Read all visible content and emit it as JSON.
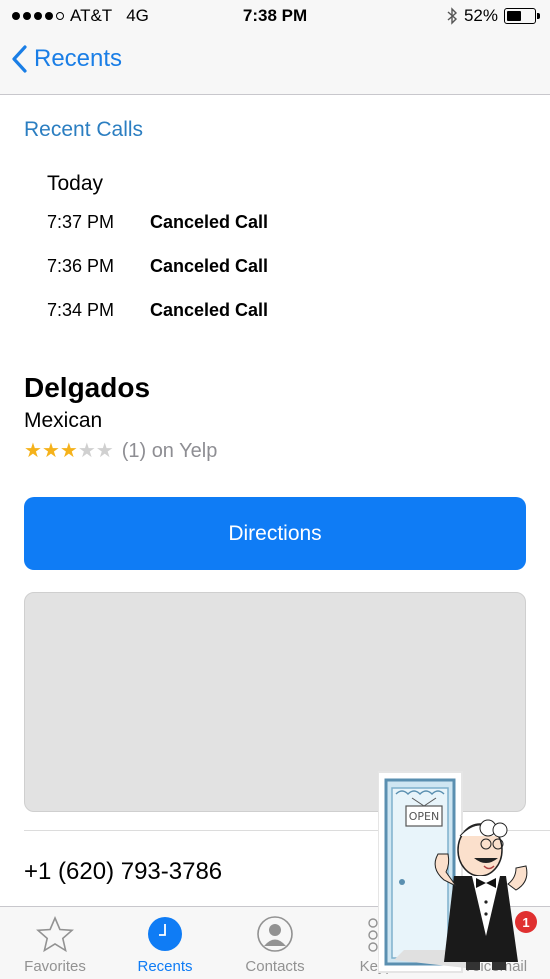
{
  "status_bar": {
    "carrier": "AT&T",
    "network": "4G",
    "time": "7:38 PM",
    "battery_percent": "52%",
    "battery_level": 0.52,
    "signal_bars": 4
  },
  "nav": {
    "back_label": "Recents"
  },
  "recent_calls": {
    "title": "Recent Calls",
    "day": "Today",
    "calls": [
      {
        "time": "7:37 PM",
        "status": "Canceled Call"
      },
      {
        "time": "7:36 PM",
        "status": "Canceled Call"
      },
      {
        "time": "7:34 PM",
        "status": "Canceled Call"
      }
    ]
  },
  "business": {
    "name": "Delgados",
    "category": "Mexican",
    "rating_stars": 3,
    "rating_max": 5,
    "rating_text": "(1) on Yelp",
    "directions_label": "Directions",
    "phone": "+1 (620) 793-3786"
  },
  "sticker": {
    "sign_text": "OPEN"
  },
  "tab_bar": {
    "tabs": [
      {
        "label": "Favorites",
        "icon": "star-icon"
      },
      {
        "label": "Recents",
        "icon": "clock-icon"
      },
      {
        "label": "Contacts",
        "icon": "person-icon"
      },
      {
        "label": "Keypad",
        "icon": "keypad-icon"
      },
      {
        "label": "Voicemail",
        "icon": "voicemail-icon",
        "badge": "1"
      }
    ]
  },
  "colors": {
    "accent": "#0f7cf5",
    "link": "#2b7ec1",
    "star": "#f5b21b"
  }
}
